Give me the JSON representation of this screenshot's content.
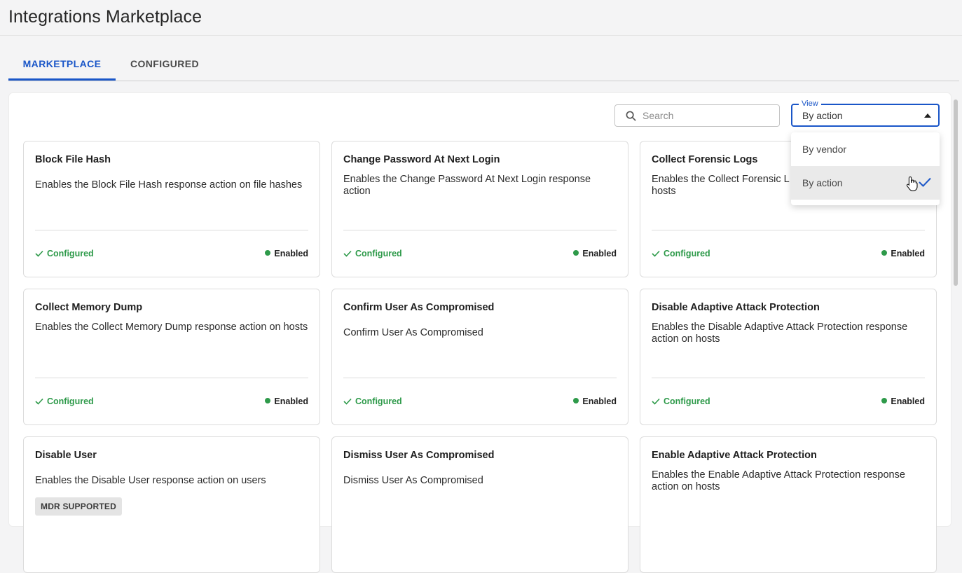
{
  "header": {
    "title": "Integrations Marketplace"
  },
  "tabs": [
    {
      "label": "MARKETPLACE",
      "active": true
    },
    {
      "label": "CONFIGURED",
      "active": false
    }
  ],
  "search": {
    "placeholder": "Search",
    "value": "",
    "icon": "search-icon"
  },
  "view": {
    "label": "View",
    "selected": "By action",
    "options": [
      {
        "label": "By vendor",
        "selected": false
      },
      {
        "label": "By action",
        "selected": true
      }
    ]
  },
  "status": {
    "configured": "Configured",
    "enabled": "Enabled"
  },
  "cards": [
    {
      "title": "Block File Hash",
      "description": "Enables the Block File Hash response action on file hashes"
    },
    {
      "title": "Change Password At Next Login",
      "description": "Enables the Change Password At Next Login response action"
    },
    {
      "title": "Collect Forensic Logs",
      "description_visible": "Enables the Collect Forensic L",
      "description_line2": "hosts"
    },
    {
      "title": "Collect Memory Dump",
      "description": "Enables the Collect Memory Dump response action on hosts"
    },
    {
      "title": "Confirm User As Compromised",
      "description": "Confirm User As Compromised"
    },
    {
      "title": "Disable Adaptive Attack Protection",
      "description": "Enables the Disable Adaptive Attack Protection response action on hosts"
    },
    {
      "title": "Disable User",
      "description": "Enables the Disable User response action on users",
      "badge": "MDR SUPPORTED"
    },
    {
      "title": "Dismiss User As Compromised",
      "description": "Dismiss User As Compromised"
    },
    {
      "title": "Enable Adaptive Attack Protection",
      "description": "Enables the Enable Adaptive Attack Protection response action on hosts"
    }
  ],
  "colors": {
    "accent": "#1a56c8",
    "success": "#2e9a4a",
    "badge_bg": "#e4e4e4"
  }
}
